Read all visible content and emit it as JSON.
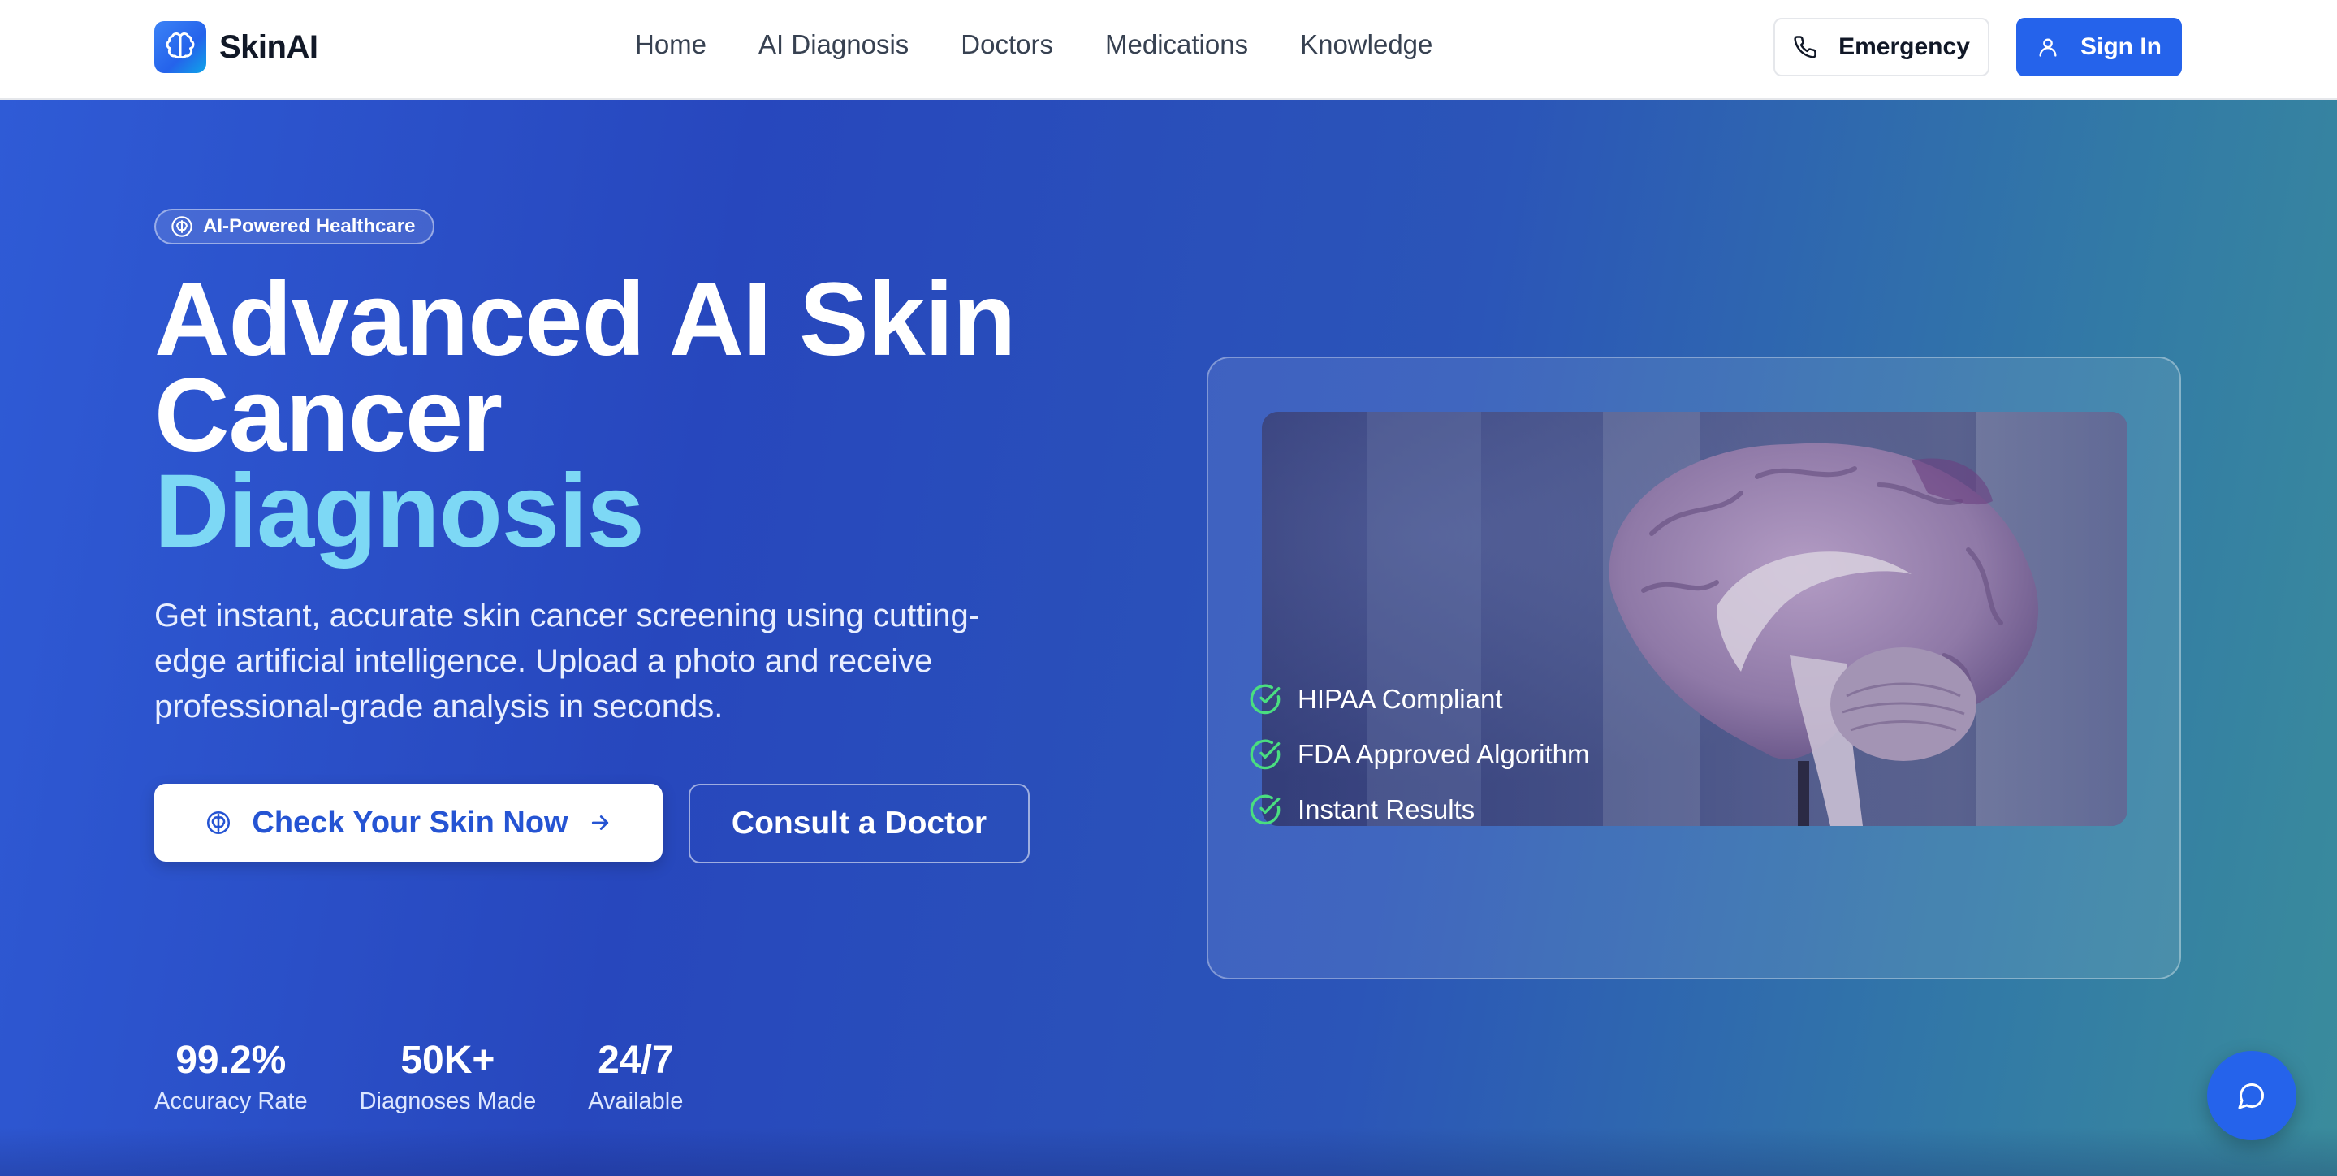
{
  "brand": {
    "name": "SkinAI"
  },
  "nav": {
    "links": [
      "Home",
      "AI Diagnosis",
      "Doctors",
      "Medications",
      "Knowledge"
    ],
    "emergency_label": "Emergency",
    "signin_label": "Sign In"
  },
  "hero": {
    "badge": "AI-Powered Healthcare",
    "headline_line1": "Advanced AI Skin",
    "headline_line2": "Cancer",
    "headline_accent": "Diagnosis",
    "subtitle": "Get instant, accurate skin cancer screening using cutting-edge artificial intelligence. Upload a photo and receive professional-grade analysis in seconds.",
    "primary_cta": "Check Your Skin Now",
    "secondary_cta": "Consult a Doctor",
    "stats": [
      {
        "value": "99.2%",
        "label": "Accuracy Rate"
      },
      {
        "value": "50K+",
        "label": "Diagnoses Made"
      },
      {
        "value": "24/7",
        "label": "Available"
      }
    ]
  },
  "card": {
    "image_alt": "brain model",
    "features": [
      "HIPAA Compliant",
      "FDA Approved Algorithm",
      "Instant Results"
    ]
  },
  "icons": {
    "logo": "brain-icon",
    "emergency": "phone-icon",
    "signin": "user-icon",
    "badge": "brain-icon",
    "cta": "brain-icon",
    "cta_arrow": "arrow-right-icon",
    "feature": "check-circle-icon",
    "chat": "chat-bubble-icon"
  },
  "colors": {
    "primary": "#2563eb",
    "accent_text": "#7dd8f5",
    "check_green": "#4ade80"
  }
}
